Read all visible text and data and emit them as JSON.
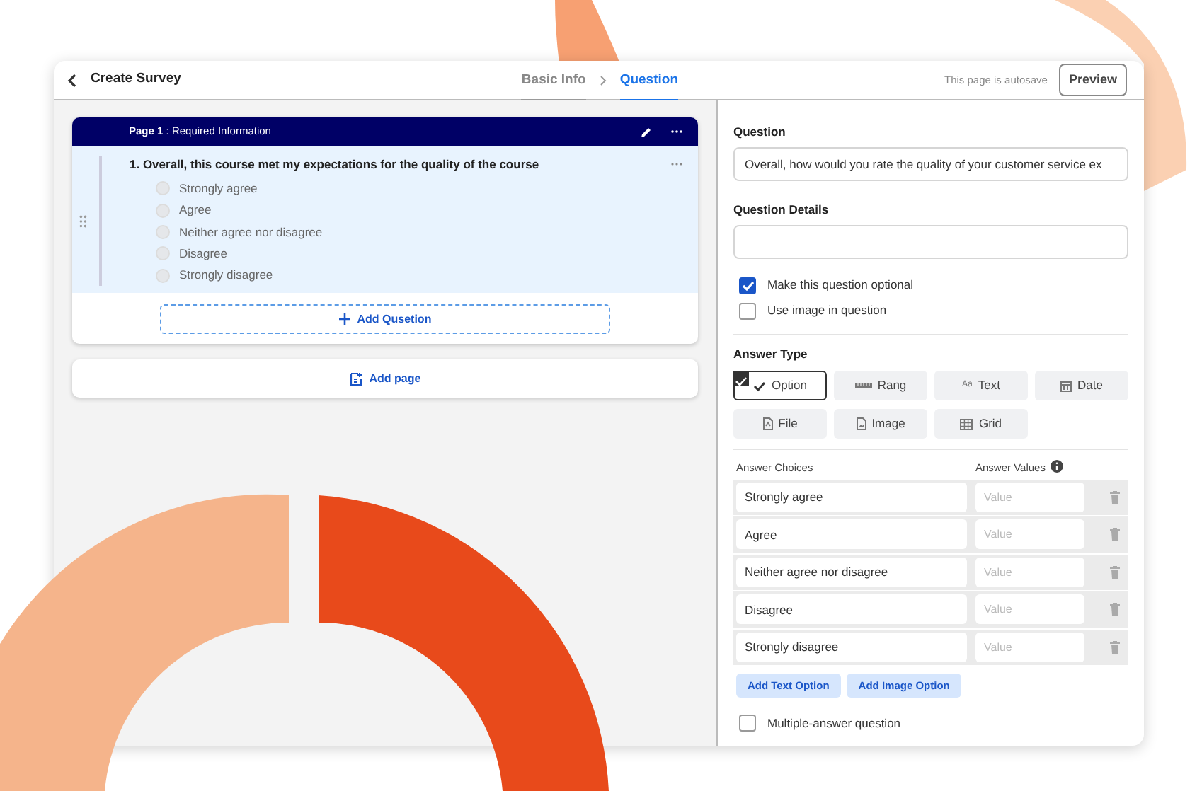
{
  "header": {
    "title": "Create Survey",
    "steps": [
      {
        "label": "Basic Info",
        "selected": false
      },
      {
        "label": "Question",
        "selected": true
      }
    ],
    "autosave": "This page is autosave",
    "preview": "Preview"
  },
  "page": {
    "heading": "**Page 1** : Required Information",
    "question": {
      "title": "1. Overall, this course met my expectations for the quality of the course",
      "options": [
        {
          "label": "Strongly agree",
          "selected": false
        },
        {
          "label": "Agree",
          "selected": false
        },
        {
          "label": "Neither agree nor disagree",
          "selected": false
        },
        {
          "label": "Disagree",
          "selected": false
        },
        {
          "label": "Strongly disagree",
          "selected": false
        }
      ]
    },
    "add_question": "Add Qusetion",
    "add_page": "Add page"
  },
  "editor": {
    "question_label": "Question",
    "question_value": "Overall, how would you rate the quality of your customer service ex",
    "details_label": "Question Details",
    "checkboxes": [
      {
        "label": "Make this question optional",
        "checked": true
      },
      {
        "label": "Use image in question",
        "checked": false
      }
    ],
    "answer_type_label": "Answer Type",
    "answer_types": [
      {
        "label": "Option",
        "kind": "check",
        "selected": true
      },
      {
        "label": "Rang",
        "kind": "range",
        "selected": false
      },
      {
        "label": "Text",
        "kind": "text",
        "glyph": "Aa",
        "selected": false
      },
      {
        "label": "Date",
        "kind": "date",
        "selected": false
      },
      {
        "label": "File",
        "kind": "file",
        "selected": false
      },
      {
        "label": "Image",
        "kind": "image",
        "selected": false
      },
      {
        "label": "Grid",
        "kind": "grid",
        "selected": false
      }
    ],
    "choices_label": "Answer Choices",
    "values_label": "Answer Values",
    "choices": [
      {
        "text": "Strongly agree",
        "placeholder": "Value"
      },
      {
        "text": "Agree",
        "placeholder": "Value"
      },
      {
        "text": "Neither agree nor disagree",
        "placeholder": "Value"
      },
      {
        "text": "Disagree",
        "placeholder": "Value"
      },
      {
        "text": "Strongly disagree",
        "placeholder": "Value"
      }
    ],
    "buttons": [
      "Add Text Option",
      "Add Image Option"
    ],
    "multiple": {
      "label": "Multiple-answer question",
      "checked": false
    }
  }
}
